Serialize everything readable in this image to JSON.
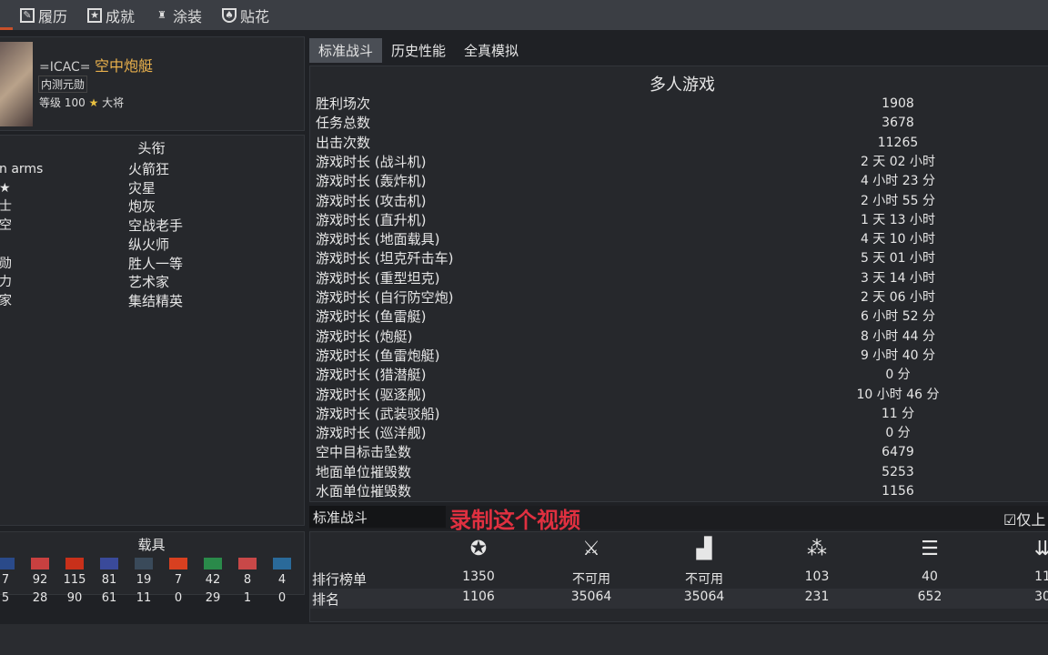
{
  "tabs": [
    {
      "label": "履历",
      "icon": "service-record-icon"
    },
    {
      "label": "成就",
      "icon": "star-achievement-icon"
    },
    {
      "label": "涂装",
      "icon": "brush-icon"
    },
    {
      "label": "贴花",
      "icon": "shield-decal-icon"
    }
  ],
  "profile": {
    "clan": "=ICAC=",
    "name": "空中炮艇",
    "badge": "内测元勋",
    "level_label": "等级",
    "level": "100",
    "rank": "大将"
  },
  "titles": {
    "heading": "头衔",
    "left": [
      "n arms",
      "★",
      "士",
      "空",
      "",
      "勋",
      "力",
      "家"
    ],
    "right": [
      "火箭狂",
      "灾星",
      "炮灰",
      "空战老手",
      "纵火师",
      "胜人一等",
      "艺术家",
      "集结精英"
    ]
  },
  "vehicles": {
    "heading": "载具",
    "columns": [
      {
        "flag": "usa",
        "a": "7",
        "b": "5"
      },
      {
        "flag": "germany",
        "a": "92",
        "b": "28"
      },
      {
        "flag": "ussr",
        "a": "115",
        "b": "90"
      },
      {
        "flag": "britain",
        "a": "81",
        "b": "61"
      },
      {
        "flag": "japan",
        "a": "19",
        "b": "11"
      },
      {
        "flag": "china",
        "a": "7",
        "b": "0"
      },
      {
        "flag": "italy",
        "a": "42",
        "b": "29"
      },
      {
        "flag": "france",
        "a": "8",
        "b": "1"
      },
      {
        "flag": "sweden",
        "a": "4",
        "b": "0"
      }
    ],
    "flag_colors": [
      "#2a4a8a",
      "#c84040",
      "#c8301a",
      "#3a4a9a",
      "#3a4a5a",
      "#d84020",
      "#2a8a4a",
      "#c84848",
      "#2a6a9a"
    ]
  },
  "subtabs": [
    "标准战斗",
    "历史性能",
    "全真模拟"
  ],
  "stats": {
    "heading": "多人游戏",
    "rows": [
      [
        "胜利场次",
        "1908"
      ],
      [
        "任务总数",
        "3678"
      ],
      [
        "出击次数",
        "11265"
      ],
      [
        "游戏时长 (战斗机)",
        "2 天 02 小时"
      ],
      [
        "游戏时长 (轰炸机)",
        "4 小时 23 分"
      ],
      [
        "游戏时长 (攻击机)",
        "2 小时 55 分"
      ],
      [
        "游戏时长 (直升机)",
        "1 天 13 小时"
      ],
      [
        "游戏时长 (地面载具)",
        "4 天 10 小时"
      ],
      [
        "游戏时长 (坦克歼击车)",
        "5 天 01 小时"
      ],
      [
        "游戏时长 (重型坦克)",
        "3 天 14 小时"
      ],
      [
        "游戏时长 (自行防空炮)",
        "2 天 06 小时"
      ],
      [
        "游戏时长 (鱼雷艇)",
        "6 小时 52 分"
      ],
      [
        "游戏时长 (炮艇)",
        "8 小时 44 分"
      ],
      [
        "游戏时长 (鱼雷炮艇)",
        "9 小时 40 分"
      ],
      [
        "游戏时长 (猎潜艇)",
        "0 分"
      ],
      [
        "游戏时长 (驱逐舰)",
        "10 小时 46 分"
      ],
      [
        "游戏时长 (武装驳船)",
        "11 分"
      ],
      [
        "游戏时长 (巡洋舰)",
        "0 分"
      ],
      [
        "空中目标击坠数",
        "6479"
      ],
      [
        "地面单位摧毁数",
        "5253"
      ],
      [
        "水面单位摧毁数",
        "1156"
      ]
    ]
  },
  "mode": {
    "selected": "标准战斗",
    "overlay": "录制这个视频",
    "checkbox": "仅上"
  },
  "ranks": {
    "row1": "排行榜单",
    "row2": "排名",
    "columns": [
      {
        "icon": "victories-icon",
        "a": "1350",
        "b": "1106"
      },
      {
        "icon": "crossed-swords-icon",
        "a": "不可用",
        "b": "35064"
      },
      {
        "icon": "podium-icon",
        "a": "不可用",
        "b": "35064"
      },
      {
        "icon": "air-kills-icon",
        "a": "103",
        "b": "231"
      },
      {
        "icon": "ground-kills-icon",
        "a": "40",
        "b": "652"
      },
      {
        "icon": "naval-kills-icon",
        "a": "11",
        "b": "30"
      }
    ]
  }
}
